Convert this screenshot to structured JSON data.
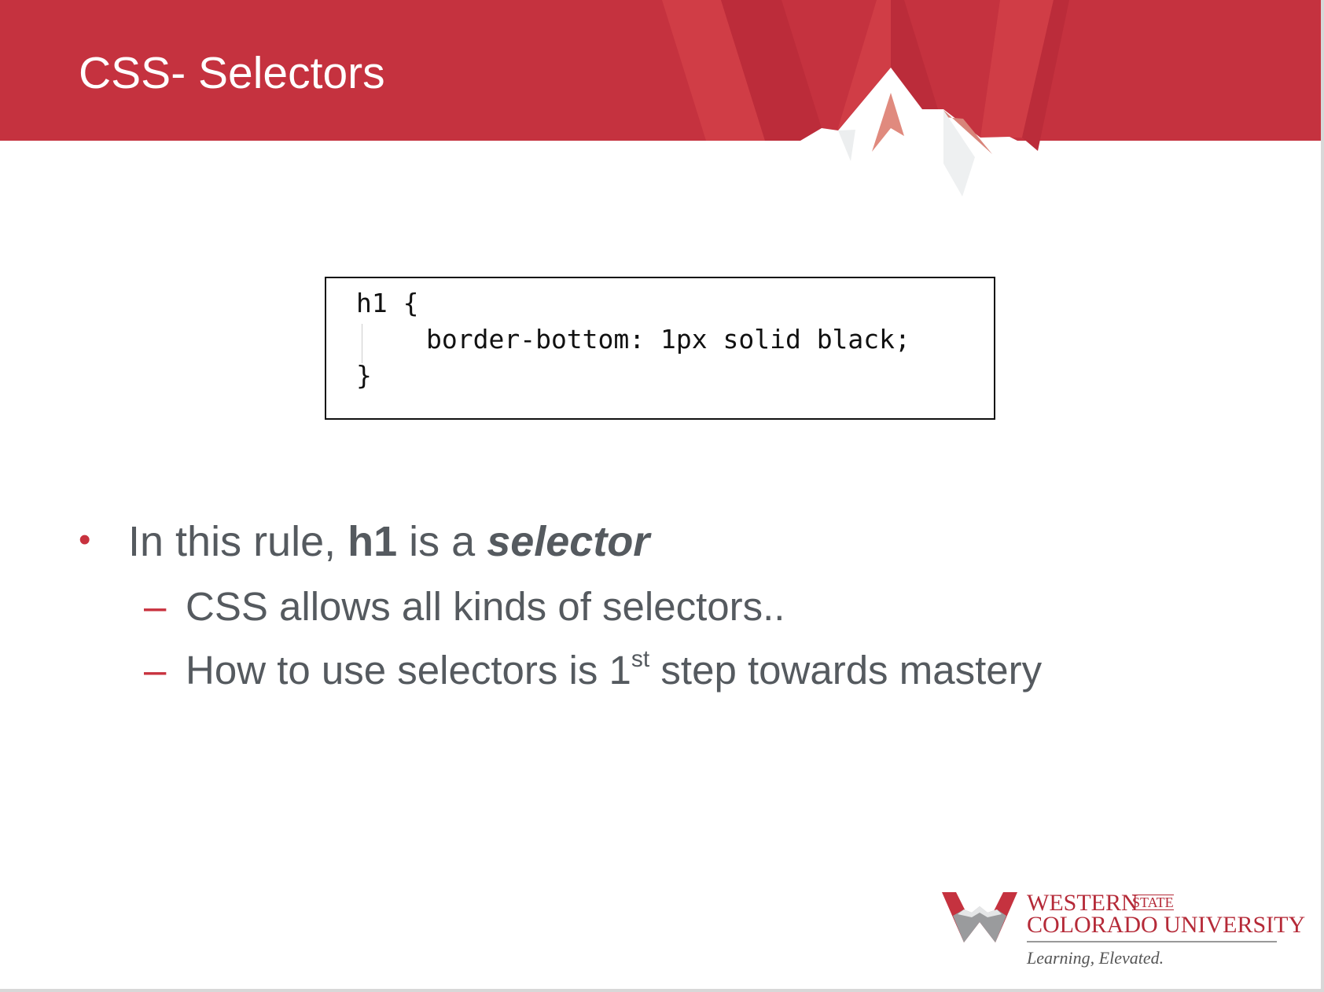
{
  "slide": {
    "title": "CSS- Selectors"
  },
  "code": {
    "lines": [
      "h1 {",
      "border-bottom: 1px solid black;",
      "}"
    ]
  },
  "bullets": {
    "main": {
      "prefix": "In this rule, ",
      "bold": "h1",
      "middle": " is a ",
      "bold_italic": "selector"
    },
    "sub": [
      {
        "text": "CSS allows all kinds of selectors.."
      },
      {
        "before": "How to use selectors is 1",
        "sup": "st",
        "after": " step towards mastery"
      }
    ]
  },
  "logo": {
    "line1": "WESTERN",
    "state": "STATE",
    "line2": "COLORADO UNIVERSITY",
    "tagline": "Learning, Elevated."
  },
  "colors": {
    "brand_red": "#c5323f",
    "text_gray": "#555a5f"
  }
}
